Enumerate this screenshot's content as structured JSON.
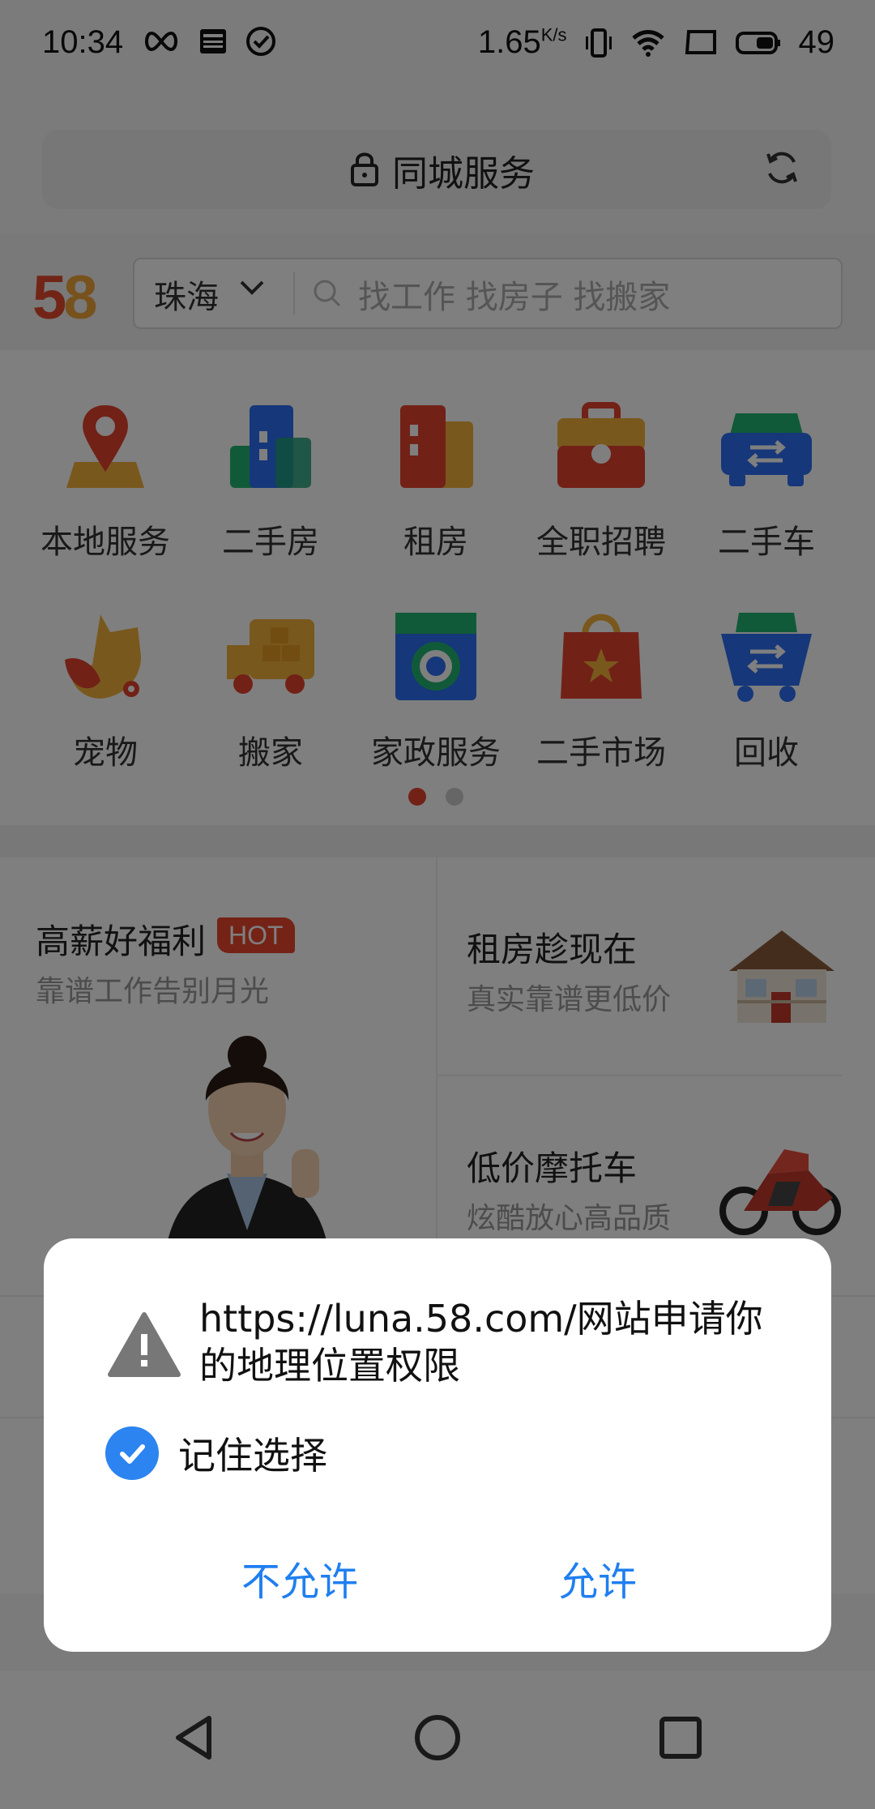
{
  "status_bar": {
    "time": "10:34",
    "net_speed": "1.65",
    "net_unit": "K/s",
    "battery": "49"
  },
  "address_bar": {
    "title": "同城服务"
  },
  "site_header": {
    "logo": "58",
    "city": "珠海",
    "search_placeholder": "找工作 找房子 找搬家"
  },
  "categories": [
    {
      "label": "本地服务",
      "icon": "location-pin-icon"
    },
    {
      "label": "二手房",
      "icon": "buildings-icon"
    },
    {
      "label": "租房",
      "icon": "apartment-icon"
    },
    {
      "label": "全职招聘",
      "icon": "briefcase-icon"
    },
    {
      "label": "二手车",
      "icon": "car-icon"
    },
    {
      "label": "宠物",
      "icon": "pet-icon"
    },
    {
      "label": "搬家",
      "icon": "moving-truck-icon"
    },
    {
      "label": "家政服务",
      "icon": "washing-machine-icon"
    },
    {
      "label": "二手市场",
      "icon": "shopping-bag-icon"
    },
    {
      "label": "回收",
      "icon": "recycle-cart-icon"
    }
  ],
  "promos": {
    "jobs": {
      "title": "高薪好福利",
      "badge": "HOT",
      "subtitle": "靠谱工作告别月光"
    },
    "rent": {
      "title": "租房趁现在",
      "subtitle": "真实靠谱更低价"
    },
    "moto": {
      "title": "低价摩托车",
      "subtitle": "炫酷放心高品质"
    }
  },
  "dialog": {
    "message": "https://luna.58.com/网站申请你的地理位置权限",
    "remember_label": "记住选择",
    "remember_checked": true,
    "deny_label": "不允许",
    "allow_label": "允许"
  },
  "colors": {
    "accent": "#1f7ff0",
    "checkbox": "#2b84f0",
    "brand_red": "#e54b2c",
    "brand_orange": "#f1a53a"
  }
}
